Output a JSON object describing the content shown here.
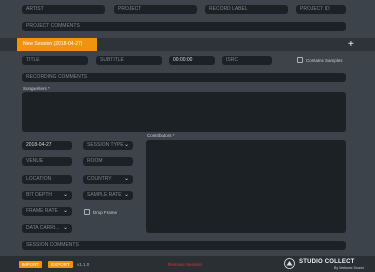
{
  "project": {
    "artist_placeholder": "ARTIST",
    "project_placeholder": "PROJECT",
    "record_label_placeholder": "RECORD LABEL",
    "project_id_placeholder": "PROJECT ID",
    "comments_placeholder": "PROJECT COMMENTS"
  },
  "session_tab": {
    "label": "New Session (2018-04-27)",
    "add_label": "+"
  },
  "recording": {
    "title_placeholder": "TITLE",
    "subtitle_placeholder": "SUBTITLE",
    "duration_value": "00:00:00",
    "isrc_placeholder": "ISRC",
    "contains_samples_label": "Contains Samples",
    "comments_placeholder": "RECORDING COMMENTS",
    "songwriters_label": "Songwriters",
    "required_mark": "*"
  },
  "session": {
    "date_value": "2018-04-27",
    "session_type_placeholder": "SESSION TYPE",
    "venue_placeholder": "VENUE",
    "room_placeholder": "ROOM",
    "location_placeholder": "LOCATION",
    "country_placeholder": "COUNTRY",
    "bit_depth_placeholder": "BIT DEPTH",
    "sample_rate_placeholder": "SAMPLE RATE",
    "frame_rate_placeholder": "FRAME RATE",
    "drop_frame_label": "Drop Frame",
    "data_carrier_placeholder": "DATA CARRI...",
    "contributors_label": "Contributors",
    "comments_placeholder": "SESSION COMMENTS",
    "chevron_icon": "chevron-down-icon"
  },
  "footer": {
    "import_label": "IMPORT",
    "export_label": "EXPORT",
    "version": "v1.1.0",
    "remove_session_label": "Remove Session",
    "logo_title": "STUDIO COLLECT",
    "logo_subtitle": "By Veritonic Sound",
    "accent_color": "#f0930f",
    "danger_color": "#e0343d"
  }
}
